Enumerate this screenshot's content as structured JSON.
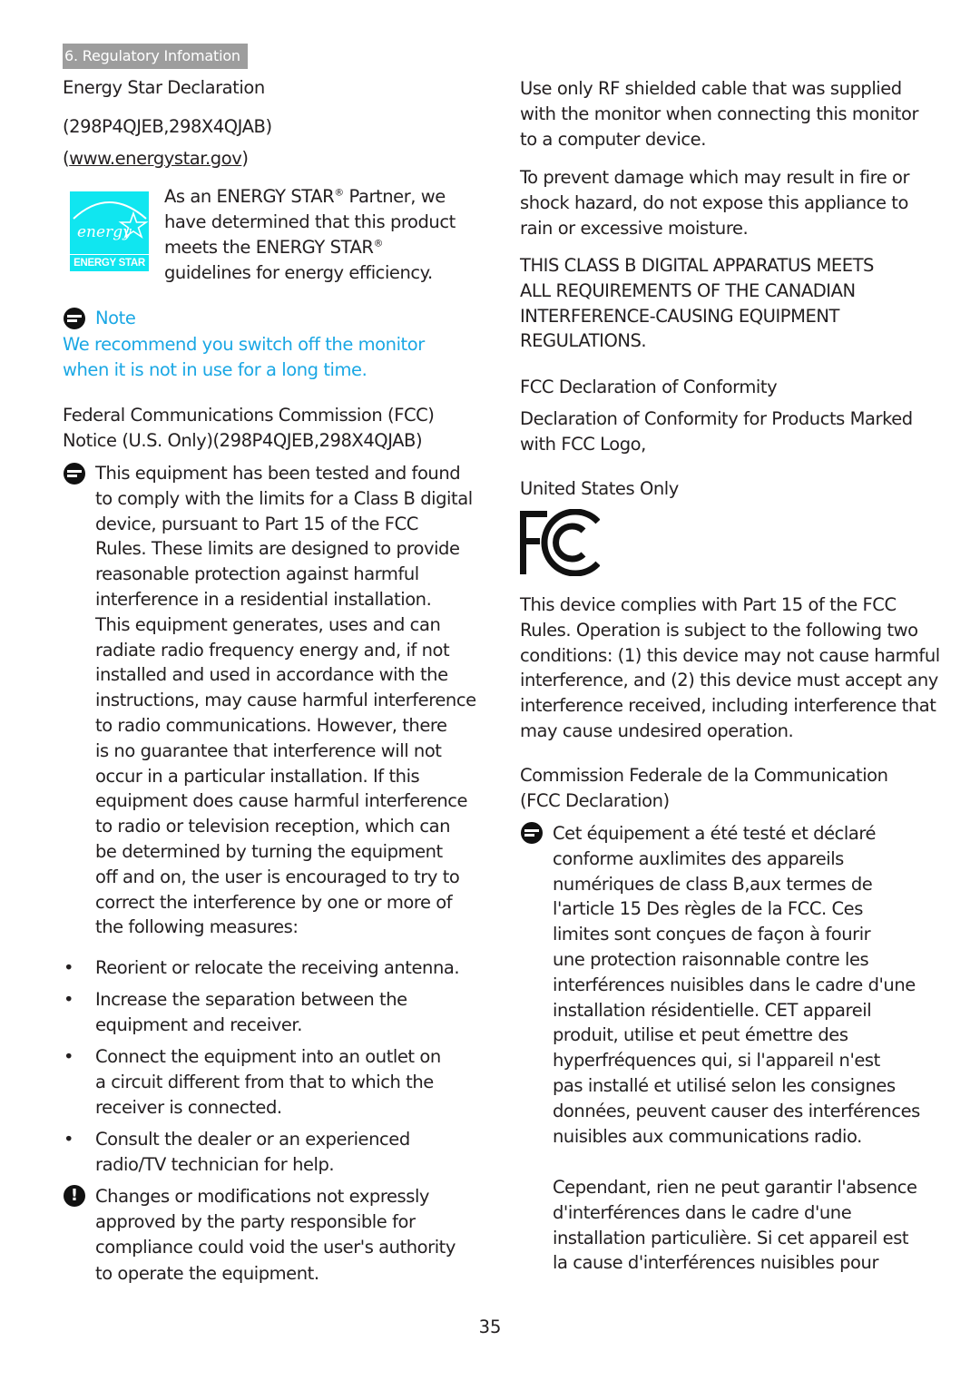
{
  "header": {
    "section_tab": "6. Regulatory Infomation"
  },
  "left": {
    "energy_star": {
      "title": "Energy Star Declaration",
      "models": "(298P4QJEB,298X4QJAB)",
      "url_open": "(",
      "url": "www.energystar.gov",
      "url_close": ")",
      "logo_script": "energy",
      "logo_label": "ENERGY STAR",
      "partner_lines": [
        "As an ENERGY STAR",
        " Partner, we",
        "have determined that this product",
        "meets the ENERGY STAR",
        "guidelines for energy efficiency."
      ],
      "registered_mark": "®"
    },
    "note": {
      "label": "Note",
      "lines": [
        "We recommend you switch off the monitor",
        "when it is not in use for a long time."
      ],
      "color": "#1aa7e4"
    },
    "fcc_notice": {
      "title_lines": [
        "Federal Communications Commission (FCC)",
        "Notice (U.S. Only)(298P4QJEB,298X4QJAB)"
      ],
      "body_lines": [
        "This equipment has been tested and found",
        "to comply with the limits for a Class B digital",
        "device, pursuant to Part 15 of the FCC",
        "Rules. These limits are designed to provide",
        "reasonable protection against harmful",
        "interference in a residential installation.",
        "This equipment generates, uses and can",
        "radiate radio frequency energy and, if not",
        "installed and used in accordance with the",
        "instructions, may cause harmful interference",
        "to radio communications. However, there",
        "is no guarantee that interference will not",
        "occur in a particular installation. If this",
        "equipment does cause harmful interference",
        "to radio or television reception, which can",
        "be determined by turning the equipment",
        "off and on, the user is encouraged to try to",
        "correct the interference by one or more of",
        "the following measures:"
      ],
      "bullets": [
        {
          "lines": [
            "Reorient or relocate the receiving antenna."
          ]
        },
        {
          "lines": [
            "Increase the separation between the",
            "equipment and receiver."
          ]
        },
        {
          "lines": [
            "Connect the equipment into an outlet on",
            "a circuit different from that to which the",
            "receiver is connected."
          ]
        },
        {
          "lines": [
            "Consult the dealer or an experienced",
            "radio/TV technician for help."
          ]
        }
      ],
      "bullet_glyph": "•",
      "warning_glyph": "!",
      "warning_lines": [
        "Changes or modifications not expressly",
        "approved by the party responsible for",
        "compliance could void the user's authority",
        "to operate the equipment."
      ]
    }
  },
  "right": {
    "rf_cable_lines": [
      "Use only RF shielded cable that was supplied",
      "with the monitor when connecting this monitor",
      "to a computer device."
    ],
    "damage_lines": [
      "To prevent damage which may result in fire or",
      "shock hazard, do not expose this appliance to",
      "rain or excessive moisture."
    ],
    "canada_lines": [
      "THIS CLASS B DIGITAL APPARATUS MEETS",
      "ALL REQUIREMENTS OF THE CANADIAN",
      "INTERFERENCE-CAUSING EQUIPMENT",
      "REGULATIONS."
    ],
    "conformity_title": "FCC Declaration of Conformity",
    "conformity_lines": [
      "Declaration of Conformity for Products Marked",
      "with FCC Logo,"
    ],
    "us_only": "United States Only",
    "compliance_lines": [
      "This device complies with Part 15 of the FCC",
      "Rules. Operation is subject to the following two",
      "conditions: (1) this device may not cause harmful",
      "interference, and (2) this device must accept any",
      "interference received, including interference that",
      "may cause undesired operation."
    ],
    "french_title_lines": [
      "Commission Federale de la Communication",
      "(FCC Declaration)"
    ],
    "french_body_lines": [
      "Cet équipement a été testé et déclaré",
      "conforme auxlimites des appareils",
      "numériques de class B,aux termes de",
      "l'article 15 Des règles de la FCC. Ces",
      "limites sont conçues de façon à fourir",
      "une protection raisonnable contre les",
      "interférences nuisibles dans le cadre d'une",
      "installation résidentielle. CET appareil",
      "produit, utilise et peut émettre des",
      "hyperfréquences qui, si l'appareil n'est",
      "pas installé et utilisé selon les consignes",
      "données, peuvent causer des interférences",
      "nuisibles aux communications radio."
    ],
    "french_body2_lines": [
      "Cependant, rien ne peut garantir l'absence",
      "d'interférences dans le cadre d'une",
      "installation particulière. Si cet appareil est",
      "la cause d'interférences nuisibles pour"
    ]
  },
  "footer": {
    "page_number": "35"
  },
  "colors": {
    "note_blue": "#1aa7e4",
    "energy_cyan": "#10e6f0",
    "tab_gray": "#9d9d9d"
  }
}
